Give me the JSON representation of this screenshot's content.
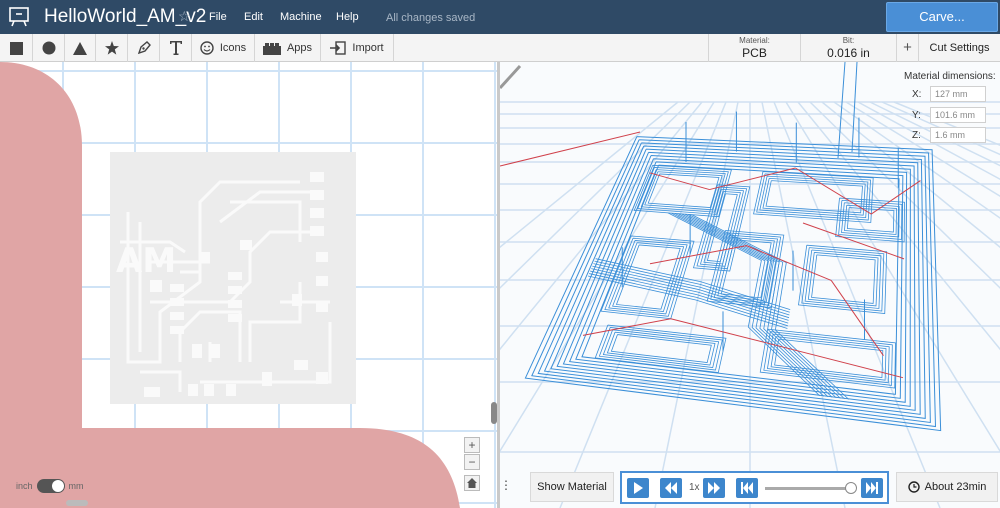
{
  "header": {
    "title": "HelloWorld_AM_v2",
    "menu": [
      "File",
      "Edit",
      "Machine",
      "Help"
    ],
    "save_status": "All changes saved",
    "carve_label": "Carve..."
  },
  "toolbar": {
    "tools": [
      "square-tool",
      "circle-tool",
      "triangle-tool",
      "star-tool",
      "pen-tool",
      "text-tool"
    ],
    "icons_label": "Icons",
    "apps_label": "Apps",
    "import_label": "Import",
    "material_caption": "Material:",
    "material_value": "PCB",
    "bit_caption": "Bit:",
    "bit_value": "0.016 in",
    "plus_label": "+",
    "cut_settings_label": "Cut Settings"
  },
  "canvas": {
    "design_text": "AM",
    "zoom_in": "+",
    "zoom_out": "−",
    "unit_left": "inch",
    "unit_right": "mm"
  },
  "material_dimensions": {
    "title": "Material dimensions:",
    "x_label": "X:",
    "x_value": "127 mm",
    "y_label": "Y:",
    "y_value": "101.6 mm",
    "z_label": "Z:",
    "z_value": "1.6 mm"
  },
  "preview": {
    "show_material_label": "Show Material",
    "speed_label": "1x",
    "progress": 1.0,
    "time_estimate": "About 23min"
  },
  "colors": {
    "header_bg": "#2f4a66",
    "carve_button": "#4a8fd6",
    "toolpath": "#3b8fd8",
    "rapid_path": "#d0414b",
    "waste_area": "#e0a5a5"
  }
}
